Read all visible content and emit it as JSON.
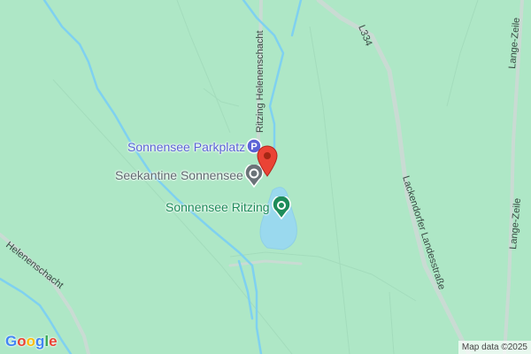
{
  "map": {
    "background_color": "#aee7c6",
    "water_color": "#9ad9ee",
    "road_color": "#c8d8d1",
    "roads": {
      "ritzing_helenenschacht": "Ritzing Helenenschacht",
      "l334": "L334",
      "lackendorfer_landesstrasse": "Lackendorfer Landesstraße",
      "lange_zeile_top": "Lange-Zeile",
      "lange_zeile_bottom": "Lange-Zeile",
      "helenenschacht": "Helenenschacht"
    },
    "pois": {
      "parking": {
        "label": "Sonnensee Parkplatz",
        "icon": "parking-icon",
        "color": "#5b63d6",
        "glyph": "P"
      },
      "restaurant": {
        "label": "Seekantine Sonnensee",
        "icon": "restaurant-icon",
        "color": "#6b7378"
      },
      "park": {
        "label": "Sonnensee Ritzing",
        "icon": "park-icon",
        "color": "#1e8c5a"
      }
    },
    "marker": {
      "icon": "red-location-pin-icon",
      "color": "#ea4335"
    },
    "logo": "Google",
    "attribution": "Map data ©2025"
  }
}
